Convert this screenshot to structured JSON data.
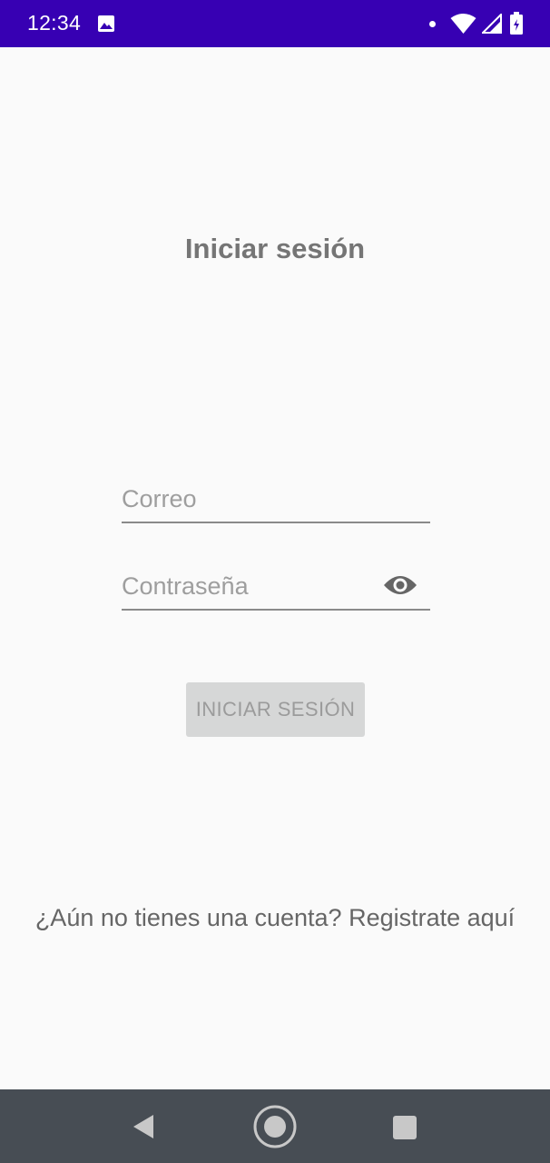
{
  "status_bar": {
    "time": "12:34",
    "background_color": "#3700b3",
    "icons": [
      "photo-icon",
      "dot-icon",
      "wifi-icon",
      "signal-icon",
      "battery-icon"
    ]
  },
  "page": {
    "title": "Iniciar sesión"
  },
  "form": {
    "email": {
      "placeholder": "Correo",
      "value": ""
    },
    "password": {
      "placeholder": "Contraseña",
      "value": "",
      "toggle_icon": "eye-icon"
    },
    "submit_label": "INICIAR SESIÓN",
    "submit_enabled": false
  },
  "footer": {
    "register_text": "¿Aún no tienes una cuenta? Registrate aquí"
  },
  "nav_bar": {
    "icons": [
      "back-icon",
      "home-icon",
      "recents-icon"
    ]
  }
}
